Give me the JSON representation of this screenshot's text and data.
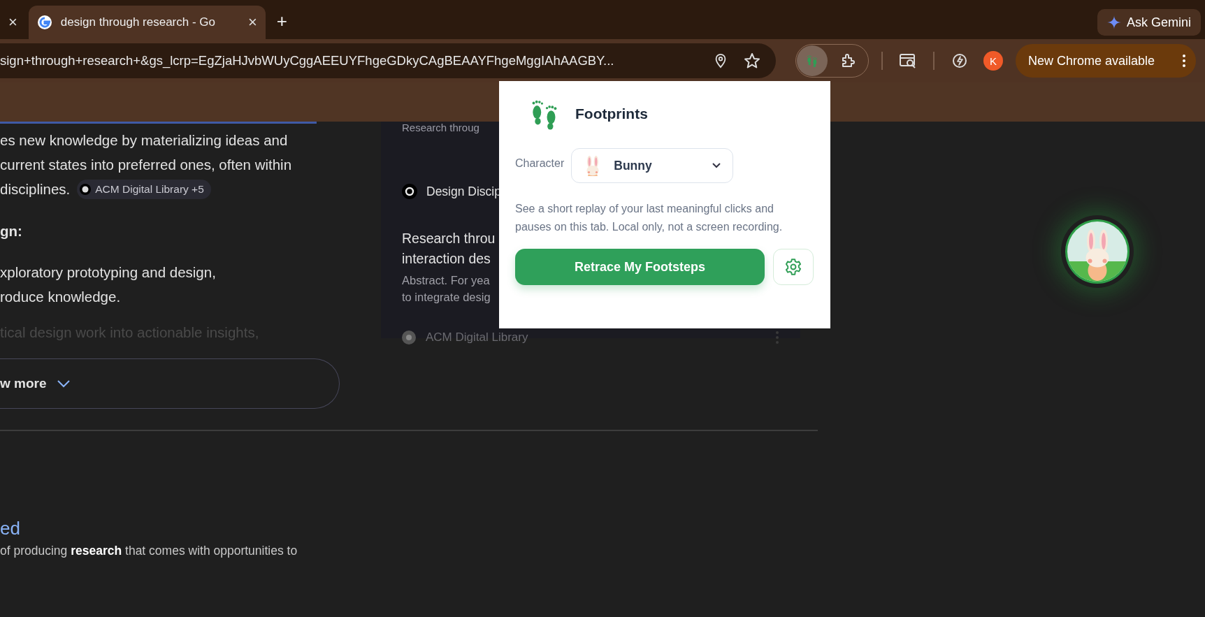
{
  "tabs": [
    {
      "close": "×",
      "selected": false
    },
    {
      "title": "design through research - Go",
      "close": "×",
      "selected": true
    }
  ],
  "new_tab": "+",
  "ask_gemini": "Ask Gemini",
  "address_bar": {
    "url": "sign+through+research+&gs_lcrp=EgZjaHJvbWUyCggAEEUYFhgeGDkyCAgBEAAYFhgeMggIAhAAGBY..."
  },
  "toolbar": {
    "extension_active": true,
    "avatar": "K",
    "update_button": "New Chrome available"
  },
  "overview": {
    "lines": [
      {
        "text": "es new knowledge by materializing ideas and",
        "kind": "plain"
      },
      {
        "text": "current states into preferred ones, often within",
        "kind": "plain"
      },
      {
        "text": "disciplines.",
        "kind": "source",
        "chip": "ACM Digital Library +5"
      },
      {
        "text": "gn:",
        "kind": "heading"
      },
      {
        "text": "xploratory prototyping and design,",
        "kind": "plain"
      },
      {
        "text": "roduce knowledge.",
        "kind": "plain"
      },
      {
        "text": "tical design work into actionable insights,",
        "kind": "faded"
      }
    ],
    "show_more": "w more"
  },
  "side_card": {
    "top_text": "Research throug",
    "source": "Design Discip",
    "title_lines": [
      "Research throu",
      "interaction des"
    ],
    "snippet_lines": [
      "Abstract. For yea",
      "to integrate desig"
    ],
    "footer_source": "ACM Digital Library"
  },
  "result": {
    "link": "ed",
    "snippet": "of producing **research** that comes with opportunities to"
  },
  "popup": {
    "title": "Footprints",
    "character_label": "Character",
    "character": "Bunny",
    "description": "See a short replay of your last meaningful clicks and pauses on this tab. Local only, not a screen recording.",
    "action": "Retrace My Footsteps"
  }
}
